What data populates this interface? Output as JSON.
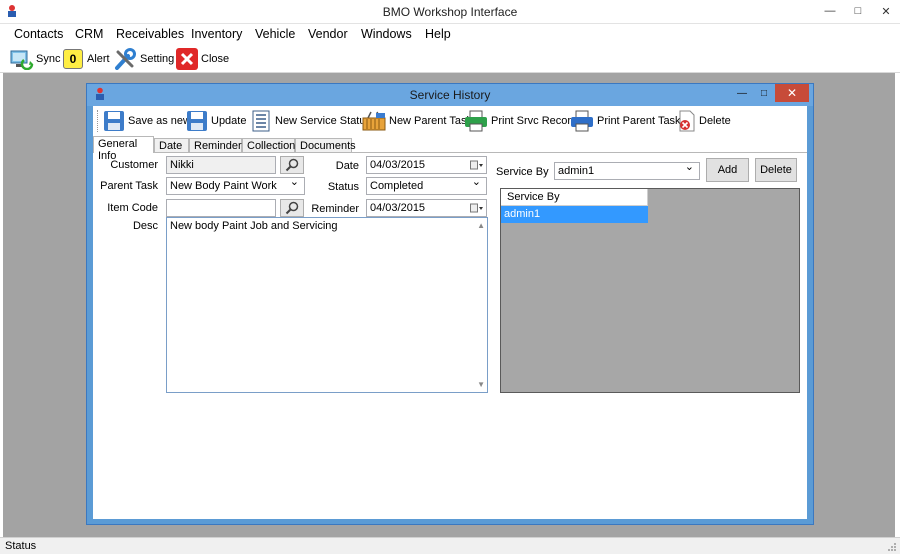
{
  "window": {
    "title": "BMO Workshop Interface"
  },
  "menu": [
    "Contacts",
    "CRM",
    "Receivables",
    "Inventory",
    "Vehicle",
    "Vendor",
    "Windows",
    "Help"
  ],
  "toolbar": {
    "sync": "Sync",
    "alert": "Alert",
    "alert_count": "0",
    "setting": "Setting",
    "close": "Close"
  },
  "child": {
    "title": "Service History",
    "toolbar": {
      "save_as_new": "Save as new",
      "update": "Update",
      "new_service_status": "New Service Status",
      "new_parent_task": "New Parent Task",
      "print_srvc_record": "Print Srvc Record",
      "print_parent_task": "Print Parent Task",
      "delete": "Delete"
    },
    "tabs": [
      "General Info",
      "Date",
      "Reminder",
      "Collection",
      "Documents"
    ],
    "form": {
      "customer_label": "Customer",
      "customer_value": "Nikki",
      "parent_task_label": "Parent Task",
      "parent_task_value": "New Body Paint Work",
      "item_code_label": "Item Code",
      "item_code_value": "",
      "desc_label": "Desc",
      "desc_value": "New body Paint Job and Servicing",
      "date_label": "Date",
      "date_value": "04/03/2015",
      "status_label": "Status",
      "status_value": "Completed",
      "reminder_label": "Reminder",
      "reminder_value": "04/03/2015",
      "service_by_label": "Service By",
      "service_by_value": "admin1",
      "add_button": "Add",
      "delete_button": "Delete"
    },
    "grid": {
      "header": "Service By",
      "rows": [
        "admin1"
      ]
    }
  },
  "status": {
    "text": "Status"
  }
}
